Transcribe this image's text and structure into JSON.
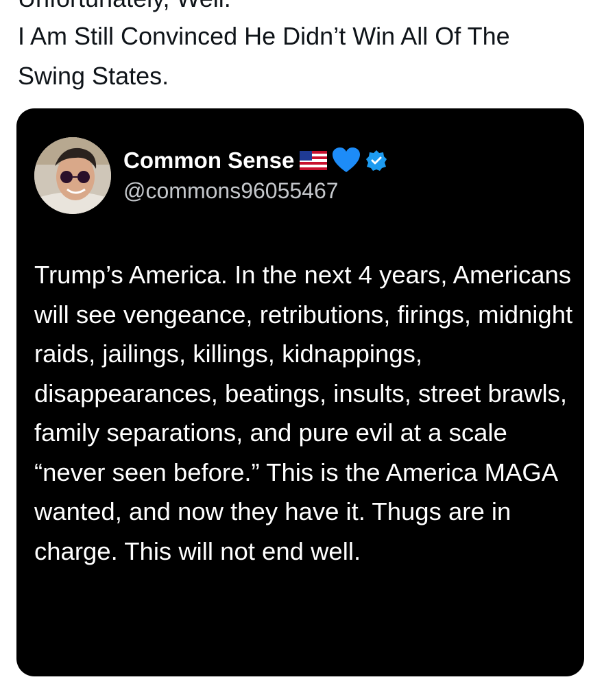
{
  "post": {
    "top_partial_text": "Unfortunately, Well.",
    "caption": "I Am Still Convinced He Didn’t Win All Of The Swing States."
  },
  "quoted_tweet": {
    "author_name": "Common Sense",
    "handle": "@commons96055467",
    "badges": [
      "us-flag-icon",
      "blue-heart-icon",
      "verified-badge-icon"
    ],
    "text": "Trump’s America. In the next 4 years, Americans will see vengeance, retributions, firings, midnight raids, jailings, killings, kidnappings, disappearances, beatings, insults, street brawls, family separations, and pure evil at a scale “never seen before.” This is the America MAGA wanted, and now they have it. Thugs are in charge. This will not end well."
  },
  "colors": {
    "card_background": "#000000",
    "handle_gray": "#c4c7cb",
    "verified_blue": "#1d9bf0",
    "heart_blue": "#1d8cf8"
  }
}
